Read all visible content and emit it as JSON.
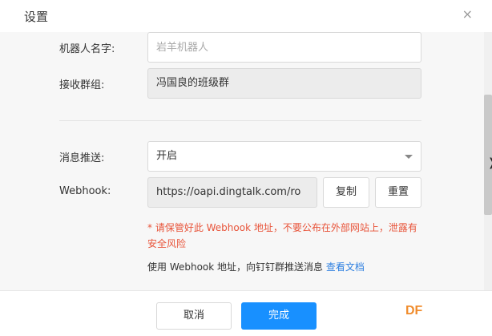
{
  "dialog": {
    "title": "设置",
    "close_icon": "×"
  },
  "form": {
    "robot_name_label": "机器人名字:",
    "robot_name_placeholder": "岩羊机器人",
    "group_label": "接收群组:",
    "group_value": "冯国良的班级群",
    "push_label": "消息推送:",
    "push_value": "开启",
    "webhook_label": "Webhook:",
    "webhook_value": "https://oapi.dingtalk.com/ro",
    "copy_label": "复制",
    "reset_label": "重置",
    "warning_text": "* 请保管好此 Webhook 地址，不要公布在外部网站上，泄露有安全风险",
    "usage_text": "使用 Webhook 地址，向钉钉群推送消息",
    "docs_link": "查看文档"
  },
  "footer": {
    "cancel_label": "取消",
    "confirm_label": "完成",
    "watermark": "DF"
  },
  "colors": {
    "accent": "#1890ff",
    "warning": "#e8543a",
    "link": "#2d7fe0",
    "watermark": "#f08c2c"
  }
}
